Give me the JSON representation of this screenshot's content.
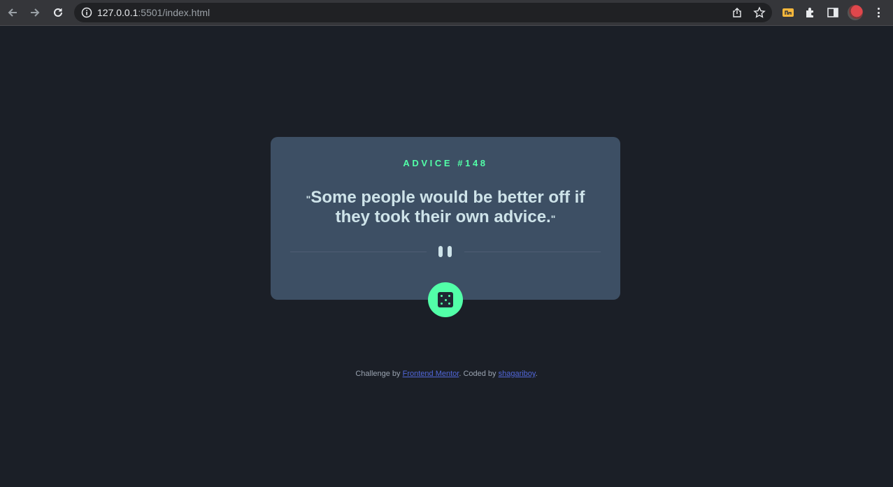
{
  "browser": {
    "url_host": "127.0.0.1",
    "url_rest": ":5501/index.html"
  },
  "icons": {
    "back": "arrow-left-icon",
    "forward": "arrow-right-icon",
    "reload": "reload-icon",
    "info": "info-icon",
    "share": "share-icon",
    "bookmark": "star-icon",
    "extension": "extension-icon",
    "puzzle": "puzzle-icon",
    "side_panel": "side-panel-icon",
    "menu": "kebab-menu-icon",
    "dice": "dice-icon",
    "divider": "pause-icon"
  },
  "card": {
    "advice_id": "ADVICE #148",
    "quote_open": "\"",
    "quote_text": "Some people would be better off if they took their own advice.",
    "quote_close": "\""
  },
  "footer": {
    "prefix": "Challenge by ",
    "link1": "Frontend Mentor",
    "middle": ". Coded by ",
    "link2": "shagariboy",
    "suffix": "."
  },
  "colors": {
    "background": "#1b1f27",
    "card": "#3d4f64",
    "accent": "#52ffa8",
    "quote": "#cee3e9",
    "link": "#5167d9"
  }
}
